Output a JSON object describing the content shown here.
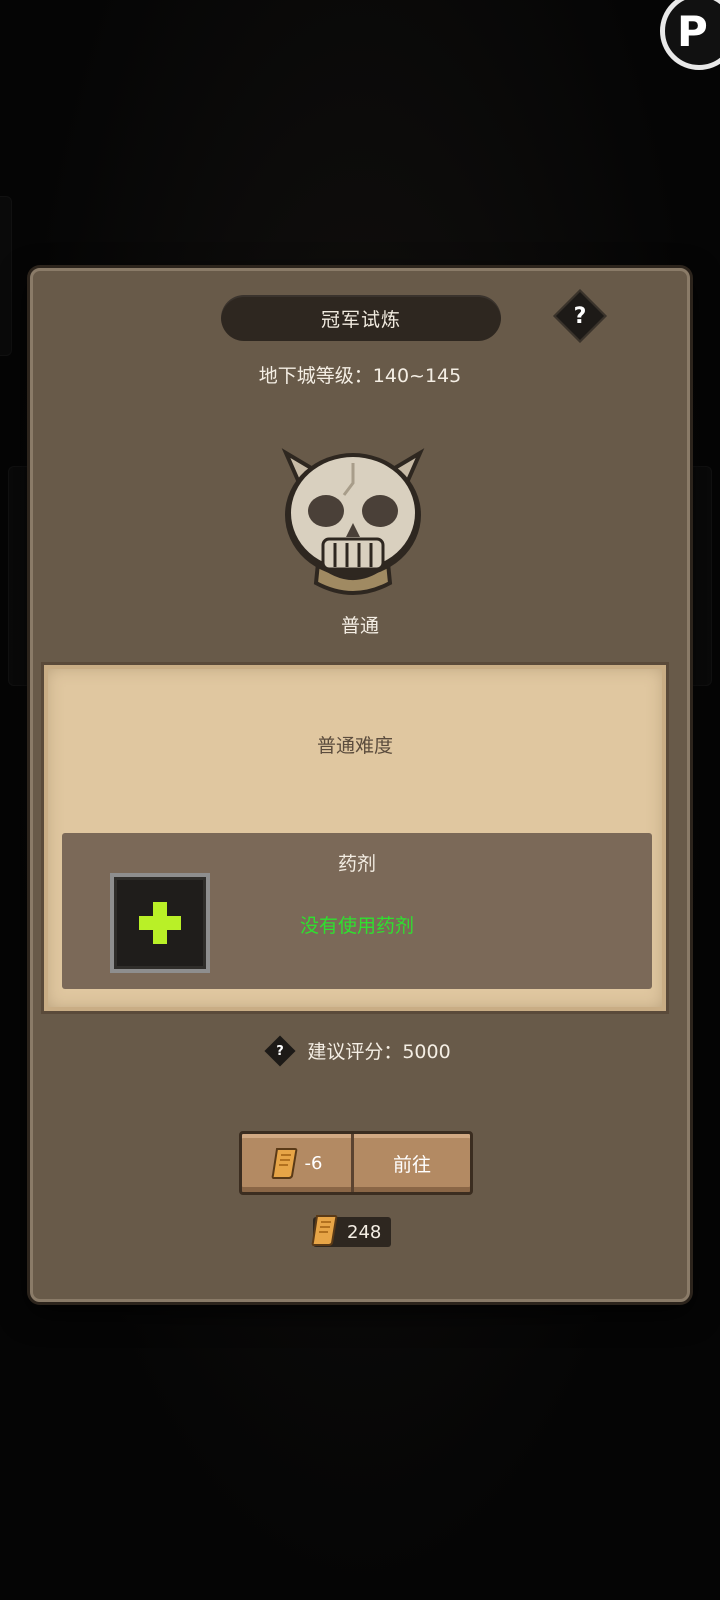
{
  "panel": {
    "title": "冠军试炼",
    "help_symbol": "?",
    "level_text": "地下城等级：140~145",
    "difficulty_name": "普通"
  },
  "card": {
    "title": "普通难度",
    "potion_title": "药剂",
    "potion_status": "没有使用药剂"
  },
  "score": {
    "help_symbol": "?",
    "text": "建议评分：5000"
  },
  "go_button": {
    "cost": "-6",
    "label": "前往"
  },
  "ticket_count": "248",
  "corner_badge": "P",
  "colors": {
    "panel": "#685a49",
    "parchment": "#e0c7a0",
    "potion_status": "#2fe02f",
    "plus": "#b9f027",
    "button": "#b38a63"
  },
  "icons": [
    "skull-icon",
    "plus-icon",
    "scroll-icon",
    "help-icon"
  ]
}
